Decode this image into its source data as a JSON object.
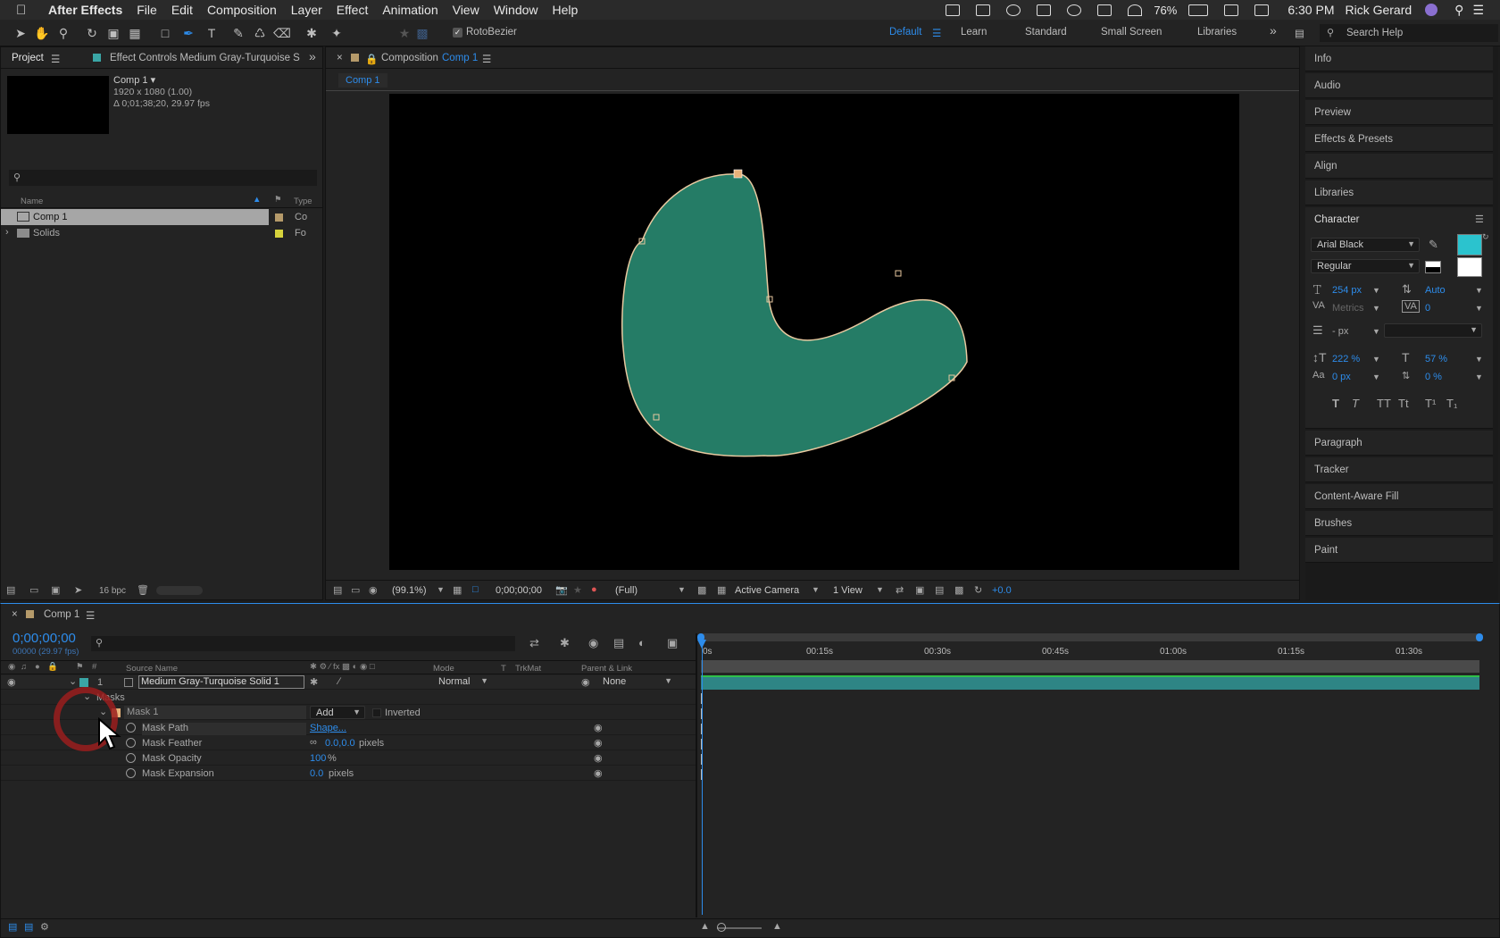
{
  "menubar": {
    "app_name": "After Effects",
    "items": [
      "File",
      "Edit",
      "Composition",
      "Layer",
      "Effect",
      "Animation",
      "View",
      "Window",
      "Help"
    ],
    "battery": "76%",
    "time": "6:30 PM",
    "user": "Rick Gerard"
  },
  "toolbar": {
    "rotobezier_label": "RotoBezier",
    "workspaces": [
      "Default",
      "Learn",
      "Standard",
      "Small Screen",
      "Libraries"
    ],
    "search_placeholder": "Search Help"
  },
  "project": {
    "tab_label": "Project",
    "effect_controls_tab": "Effect Controls Medium Gray-Turquoise S",
    "comp_name": "Comp 1 ▾",
    "comp_size": "1920 x 1080 (1.00)",
    "comp_duration": "Δ 0;01;38;20, 29.97 fps",
    "col_name": "Name",
    "col_type": "Type",
    "items": [
      {
        "name": "Comp 1",
        "type": "Co",
        "color": "#b59a6a"
      },
      {
        "name": "Solids",
        "type": "Fo",
        "color": "#d6d23c"
      }
    ],
    "bpc": "16 bpc"
  },
  "composition": {
    "tab_prefix": "Composition",
    "tab_name": "Comp 1",
    "subtab": "Comp 1",
    "zoom": "(99.1%)",
    "timecode": "0;00;00;00",
    "resolution": "(Full)",
    "camera": "Active Camera",
    "view": "1 View",
    "exposure": "+0.0",
    "shape_color": "#257c66"
  },
  "right_panel": {
    "items_top": [
      "Info",
      "Audio",
      "Preview",
      "Effects & Presets",
      "Align",
      "Libraries"
    ],
    "character": {
      "title": "Character",
      "font": "Arial Black",
      "style": "Regular",
      "size": "254 px",
      "leading": "Auto",
      "kerning": "Metrics",
      "tracking": "0",
      "stroke": "- px",
      "vscale": "222 %",
      "hscale": "57 %",
      "baseline": "0 px",
      "tsume": "0 %",
      "fill_color": "#2bc3ce",
      "format_buttons": [
        "T",
        "T",
        "TT",
        "Tt",
        "T¹",
        "T₁"
      ]
    },
    "items_bottom": [
      "Paragraph",
      "Tracker",
      "Content-Aware Fill",
      "Brushes",
      "Paint"
    ]
  },
  "timeline": {
    "tab_label": "Comp 1",
    "timecode": "0;00;00;00",
    "frame_info": "00000 (29.97 fps)",
    "cols": {
      "source": "Source Name",
      "mode": "Mode",
      "t": "T",
      "trkmat": "TrkMat",
      "parent": "Parent & Link"
    },
    "layer": {
      "num": "1",
      "name": "Medium Gray-Turquoise Solid 1",
      "mode": "Normal",
      "parent": "None",
      "color": "#3aa6a6"
    },
    "masks_label": "Masks",
    "mask": {
      "name": "Mask 1",
      "mode": "Add",
      "inverted": "Inverted",
      "color": "#e8b27a"
    },
    "props": [
      {
        "name": "Mask Path",
        "value": "Shape...",
        "unit": ""
      },
      {
        "name": "Mask Feather",
        "value": "0.0,0.0",
        "unit": " pixels"
      },
      {
        "name": "Mask Opacity",
        "value": "100",
        "unit": "%"
      },
      {
        "name": "Mask Expansion",
        "value": "0.0",
        "unit": " pixels"
      }
    ],
    "ruler": [
      "0s",
      "00:15s",
      "00:30s",
      "00:45s",
      "01:00s",
      "01:15s",
      "01:30s"
    ]
  }
}
